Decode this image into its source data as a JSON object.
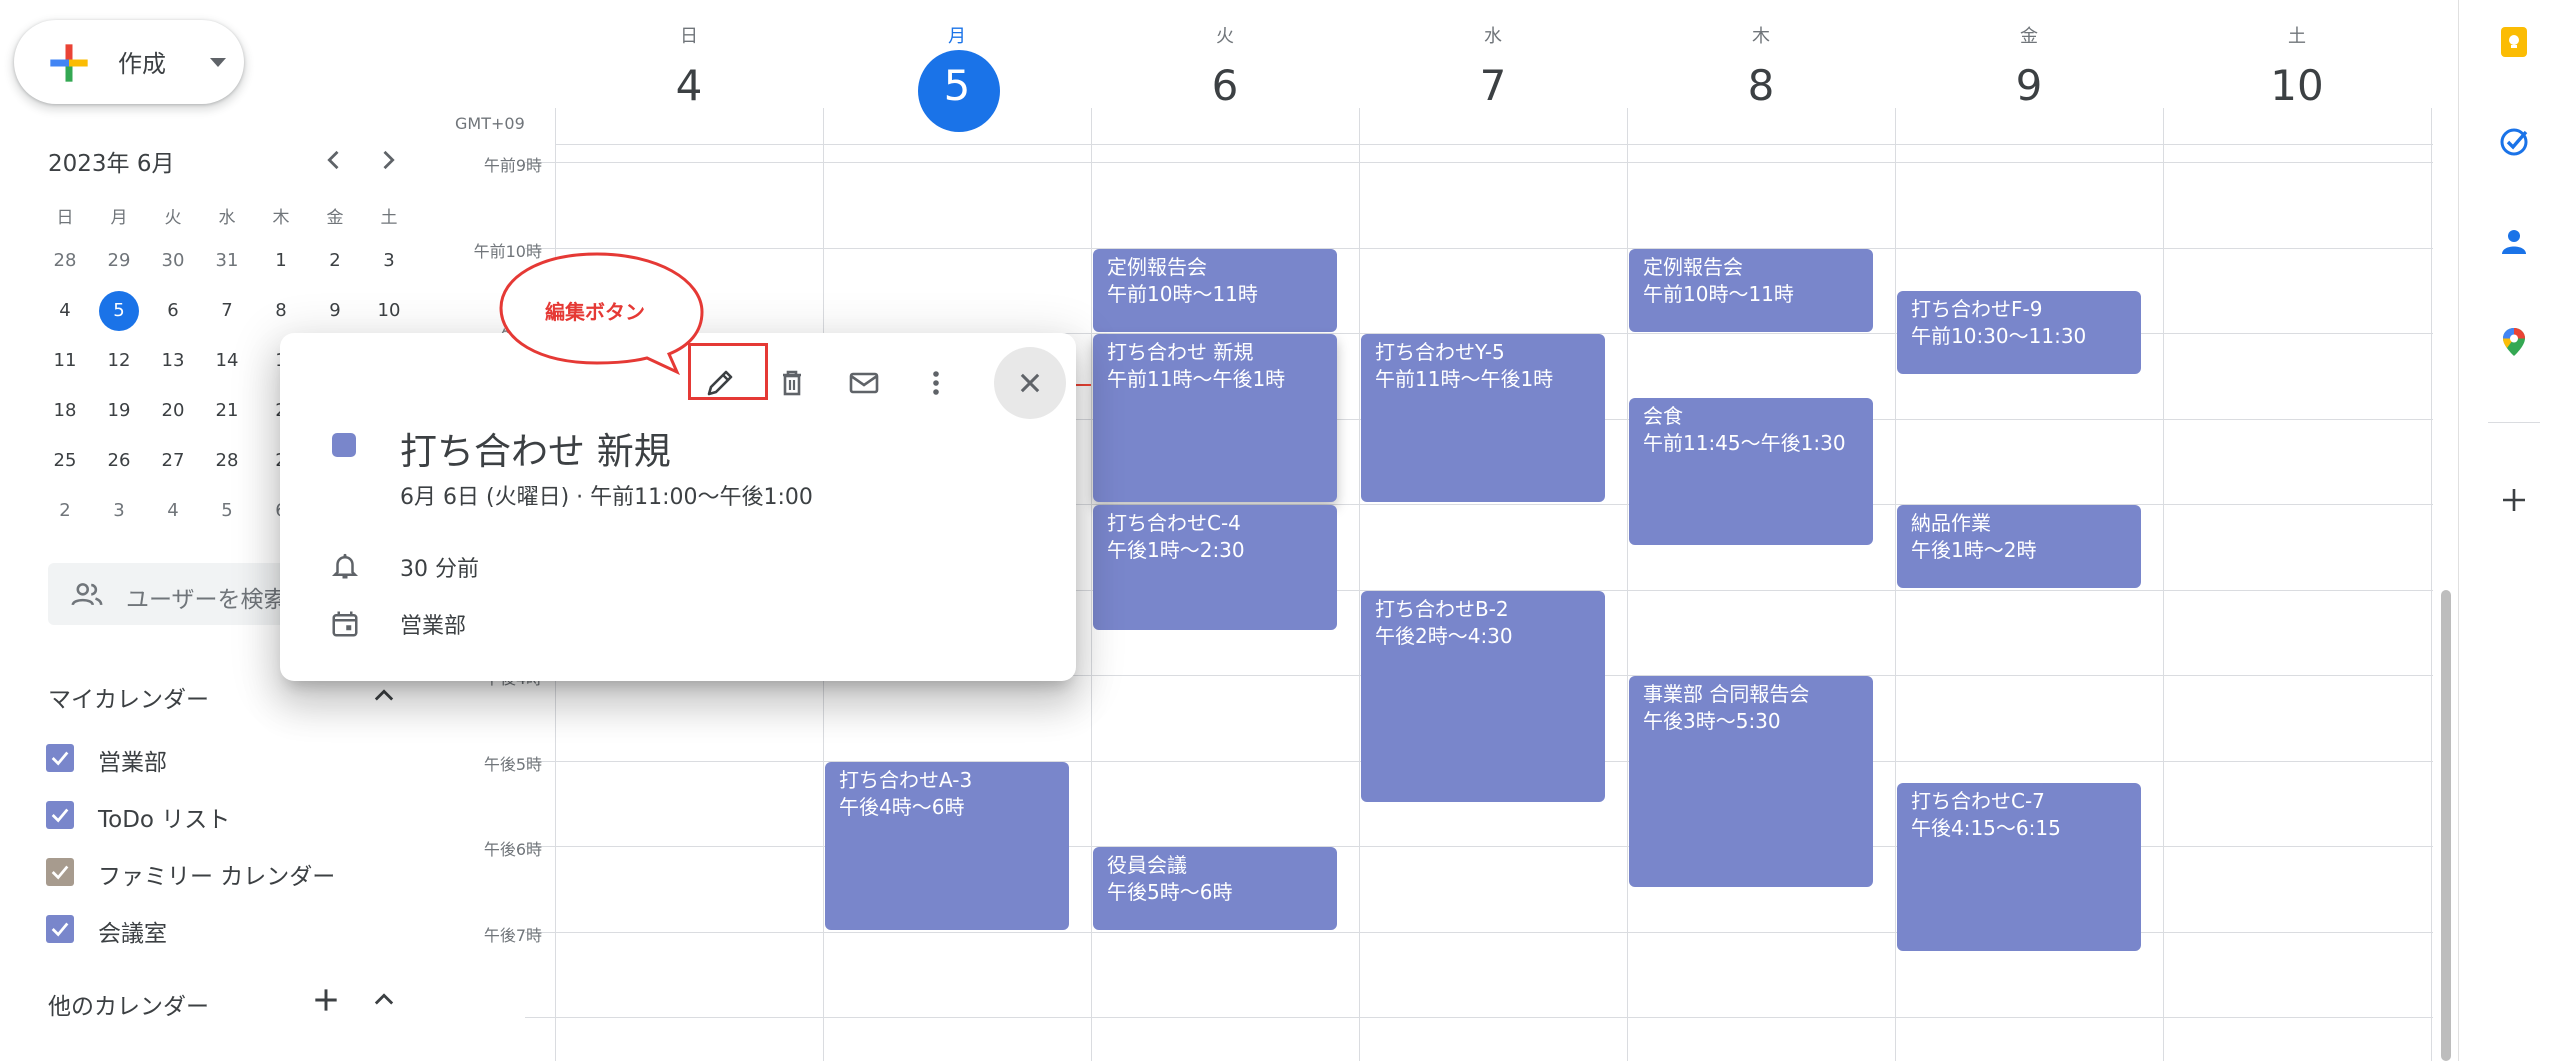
{
  "create": {
    "label": "作成"
  },
  "mini_calendar": {
    "title": "2023年 6月",
    "weekdays": [
      "日",
      "月",
      "火",
      "水",
      "木",
      "金",
      "土"
    ],
    "rows": [
      [
        "28",
        "29",
        "30",
        "31",
        "1",
        "2",
        "3"
      ],
      [
        "4",
        "5",
        "6",
        "7",
        "8",
        "9",
        "10"
      ],
      [
        "11",
        "12",
        "13",
        "14",
        "1",
        "",
        ""
      ],
      [
        "18",
        "19",
        "20",
        "21",
        "2",
        "",
        ""
      ],
      [
        "25",
        "26",
        "27",
        "28",
        "2",
        "",
        ""
      ],
      [
        "2",
        "3",
        "4",
        "5",
        "6",
        "",
        ""
      ]
    ],
    "today": "5"
  },
  "people_search": {
    "placeholder": "ユーザーを検索"
  },
  "my_calendars": {
    "title": "マイカレンダー",
    "items": [
      {
        "label": "営業部",
        "color": "#7986cb"
      },
      {
        "label": "ToDo リスト",
        "color": "#7986cb"
      },
      {
        "label": "ファミリー カレンダー",
        "color": "#a79b8e"
      },
      {
        "label": "会議室",
        "color": "#7986cb"
      }
    ]
  },
  "other_calendars": {
    "title": "他のカレンダー"
  },
  "week": {
    "timezone": "GMT+09",
    "days": [
      {
        "dow": "日",
        "num": "4"
      },
      {
        "dow": "月",
        "num": "5",
        "today": true
      },
      {
        "dow": "火",
        "num": "6"
      },
      {
        "dow": "水",
        "num": "7"
      },
      {
        "dow": "木",
        "num": "8"
      },
      {
        "dow": "金",
        "num": "9"
      },
      {
        "dow": "土",
        "num": "10"
      }
    ],
    "time_labels": [
      "午前9時",
      "午前10時",
      "",
      "",
      "",
      "",
      "午後4時",
      "午後5時",
      "午後6時",
      "午後7時"
    ],
    "partial_label": "午前1"
  },
  "events": [
    {
      "title": "定例報告会",
      "time": "午前10時〜11時"
    },
    {
      "title": "打ち合わせ 新規",
      "time": "午前11時〜午後1時"
    },
    {
      "title": "打ち合わせC-4",
      "time": "午後1時〜2:30"
    },
    {
      "title": "役員会議",
      "time": "午後5時〜6時"
    },
    {
      "title": "打ち合わせY-5",
      "time": "午前11時〜午後1時"
    },
    {
      "title": "打ち合わせB-2",
      "time": "午後2時〜4:30"
    },
    {
      "title": "定例報告会",
      "time": "午前10時〜11時"
    },
    {
      "title": "会食",
      "time": "午前11:45〜午後1:30"
    },
    {
      "title": "事業部 合同報告会",
      "time": "午後3時〜5:30"
    },
    {
      "title": "打ち合わせF-9",
      "time": "午前10:30〜11:30"
    },
    {
      "title": "納品作業",
      "time": "午後1時〜2時"
    },
    {
      "title": "打ち合わせC-7",
      "time": "午後4:15〜6:15"
    },
    {
      "title": "打ち合わせA-3",
      "time": "午後4時〜6時"
    }
  ],
  "popup": {
    "title": "打ち合わせ 新規",
    "date": "6月 6日 (火曜日)  ·  午前11:00〜午後1:00",
    "reminder": "30 分前",
    "calendar": "営業部",
    "event_color": "#7986cb"
  },
  "annotation": {
    "label": "編集ボタン",
    "color": "#e53935"
  },
  "colors": {
    "accent": "#1a73e8",
    "event": "#7986cb"
  }
}
